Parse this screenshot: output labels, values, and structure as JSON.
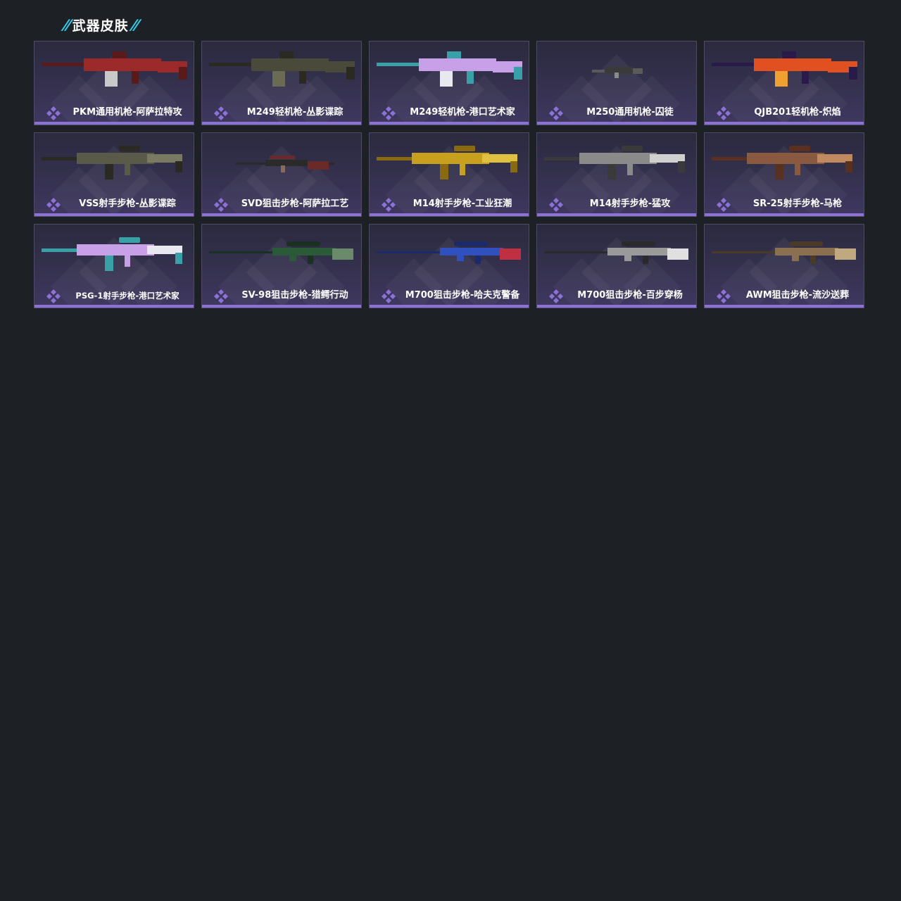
{
  "section": {
    "title": "武器皮肤",
    "slashes": "//"
  },
  "colors": {
    "background": "#1d2025",
    "accent_cyan": "#2fd0f0",
    "card_border": "#4f4a66",
    "rarity_purple": "#8c72d6"
  },
  "skins": [
    {
      "name": "PKM通用机枪-阿萨拉特攻",
      "icon": "rarity-diamond-icon",
      "palette": [
        "#5a1a1a",
        "#9c2a2a",
        "#c9c9c9"
      ],
      "shape": "lmg"
    },
    {
      "name": "M249轻机枪-丛影谍踪",
      "icon": "rarity-diamond-icon",
      "palette": [
        "#2a2a22",
        "#4a4a3a",
        "#6a6a55"
      ],
      "shape": "lmg"
    },
    {
      "name": "M249轻机枪-港口艺术家",
      "icon": "rarity-diamond-icon",
      "palette": [
        "#3aa0a8",
        "#c8a0e8",
        "#e8e8f0"
      ],
      "shape": "lmg"
    },
    {
      "name": "M250通用机枪-囚徒",
      "icon": "rarity-diamond-icon",
      "palette": [
        "#3a3a3a",
        "#5a5a5a",
        "#8a8a8a"
      ],
      "shape": "tiny"
    },
    {
      "name": "QJB201轻机枪-炽焰",
      "icon": "rarity-diamond-icon",
      "palette": [
        "#2a1a4a",
        "#e05020",
        "#f0a030"
      ],
      "shape": "lmg"
    },
    {
      "name": "VSS射手步枪-丛影谍踪",
      "icon": "rarity-diamond-icon",
      "palette": [
        "#2a2a22",
        "#5a5a48",
        "#7a7a62"
      ],
      "shape": "rifle"
    },
    {
      "name": "SVD狙击步枪-阿萨拉工艺",
      "icon": "rarity-diamond-icon",
      "palette": [
        "#2a2a2a",
        "#6a2a2a",
        "#8a6a5a"
      ],
      "shape": "sniper_small"
    },
    {
      "name": "M14射手步枪-工业狂潮",
      "icon": "rarity-diamond-icon",
      "palette": [
        "#8a6a10",
        "#c8a020",
        "#e0c040"
      ],
      "shape": "rifle"
    },
    {
      "name": "M14射手步枪-猛攻",
      "icon": "rarity-diamond-icon",
      "palette": [
        "#3a3a3a",
        "#8a8a8a",
        "#d0d0d0"
      ],
      "shape": "rifle"
    },
    {
      "name": "SR-25射手步枪-马枪",
      "icon": "rarity-diamond-icon",
      "palette": [
        "#5a3020",
        "#8a5a40",
        "#c08a60"
      ],
      "shape": "rifle"
    },
    {
      "name": "PSG-1射手步枪-港口艺术家",
      "icon": "rarity-diamond-icon",
      "palette": [
        "#3aa0a8",
        "#c8a0e8",
        "#e8e8f0"
      ],
      "shape": "rifle",
      "small": true
    },
    {
      "name": "SV-98狙击步枪-猎鳄行动",
      "icon": "rarity-diamond-icon",
      "palette": [
        "#1a3020",
        "#2a5a38",
        "#6a8a6a"
      ],
      "shape": "sniper"
    },
    {
      "name": "M700狙击步枪-哈夫克警备",
      "icon": "rarity-diamond-icon",
      "palette": [
        "#1a2a6a",
        "#3050c0",
        "#c03040"
      ],
      "shape": "sniper"
    },
    {
      "name": "M700狙击步枪-百步穿杨",
      "icon": "rarity-diamond-icon",
      "palette": [
        "#2a2a2a",
        "#9a9a9a",
        "#e0e0e0"
      ],
      "shape": "sniper"
    },
    {
      "name": "AWM狙击步枪-流沙送葬",
      "icon": "rarity-diamond-icon",
      "palette": [
        "#4a3a28",
        "#8a7050",
        "#c0a880"
      ],
      "shape": "sniper"
    }
  ]
}
